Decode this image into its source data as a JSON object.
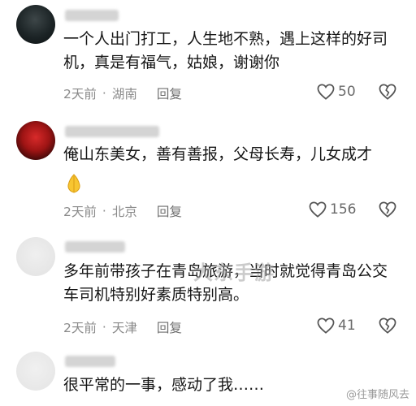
{
  "comments": [
    {
      "text": "一个人出门打工，人生地不熟，遇上这样的好司机，真是有福气，姑娘，谢谢你",
      "time": "2天前",
      "location": "湖南",
      "reply_label": "回复",
      "likes": "50"
    },
    {
      "text": "俺山东美女，善有善报，父母长寿，儿女成才",
      "time": "2天前",
      "location": "北京",
      "reply_label": "回复",
      "likes": "156"
    },
    {
      "text": "多年前带孩子在青岛旅游，当时就觉得青岛公交车司机特别好素质特别高。",
      "time": "2天前",
      "location": "天津",
      "reply_label": "回复",
      "likes": "41"
    },
    {
      "text": "很平常的一事，感动了我……"
    }
  ],
  "watermark": "大东手游",
  "source_tag": "@往事随风去",
  "icons": [
    "heart-icon",
    "broken-heart-icon",
    "folded-hands-emoji-icon"
  ]
}
